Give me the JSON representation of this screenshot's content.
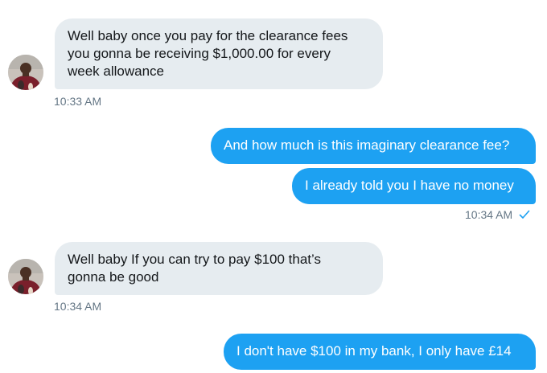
{
  "conversation": {
    "messages": [
      {
        "direction": "incoming",
        "lines": [
          "Well baby once you pay for the clearance fees",
          "you gonna be receiving $1,000.00 for every",
          "week allowance"
        ],
        "timestamp": "10:33 AM"
      },
      {
        "direction": "outgoing",
        "lines": [
          "And how much is this imaginary clearance fee?"
        ]
      },
      {
        "direction": "outgoing",
        "lines": [
          "I already told you I have no money"
        ],
        "timestamp": "10:34 AM",
        "status_icon": "checkmark-icon"
      },
      {
        "direction": "incoming",
        "lines": [
          "Well baby If you can try to pay $100 that’s",
          "gonna be good"
        ],
        "timestamp": "10:34 AM"
      },
      {
        "direction": "outgoing",
        "lines": [
          "I don't have $100 in my bank, I only have £14"
        ]
      }
    ]
  },
  "colors": {
    "incoming_bubble": "#e6ecf0",
    "outgoing_bubble": "#1da1f2",
    "timestamp": "#657786",
    "checkmark": "#1da1f2"
  }
}
